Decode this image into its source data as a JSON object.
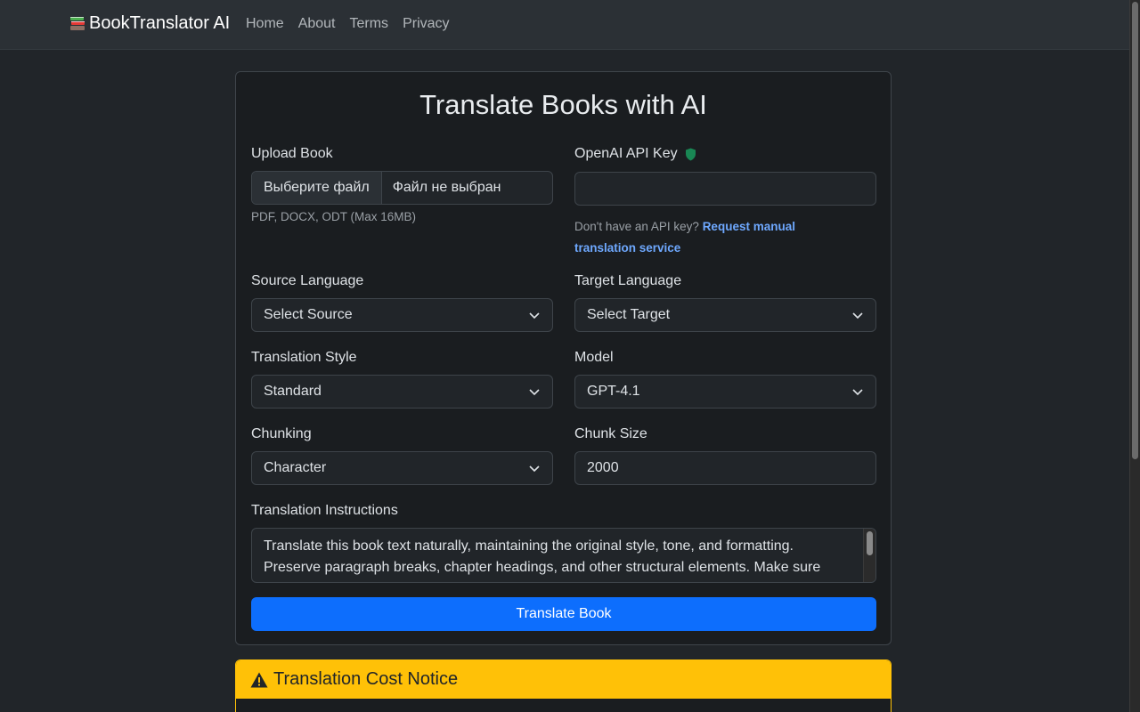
{
  "navbar": {
    "brand": "BookTranslator AI",
    "links": [
      "Home",
      "About",
      "Terms",
      "Privacy"
    ]
  },
  "form": {
    "title": "Translate Books with AI",
    "upload": {
      "label": "Upload Book",
      "button": "Выберите файл",
      "file_status": "Файл не выбран",
      "hint": "PDF, DOCX, ODT (Max 16MB)"
    },
    "api_key": {
      "label": "OpenAI API Key",
      "value": "",
      "hint_text": "Don't have an API key?",
      "hint_link": "Request manual translation service"
    },
    "source_language": {
      "label": "Source Language",
      "value": "Select Source"
    },
    "target_language": {
      "label": "Target Language",
      "value": "Select Target"
    },
    "translation_style": {
      "label": "Translation Style",
      "value": "Standard"
    },
    "model": {
      "label": "Model",
      "value": "GPT-4.1"
    },
    "chunking": {
      "label": "Chunking",
      "value": "Character"
    },
    "chunk_size": {
      "label": "Chunk Size",
      "value": "2000"
    },
    "instructions": {
      "label": "Translation Instructions",
      "value": "Translate this book text naturally, maintaining the original style, tone, and formatting. Preserve paragraph breaks, chapter headings, and other structural elements. Make sure"
    },
    "submit": "Translate Book"
  },
  "notice": {
    "title": "Translation Cost Notice"
  },
  "colors": {
    "primary": "#0d6efd",
    "warning": "#ffc107",
    "shield": "#198754",
    "link": "#6ea8fe"
  }
}
